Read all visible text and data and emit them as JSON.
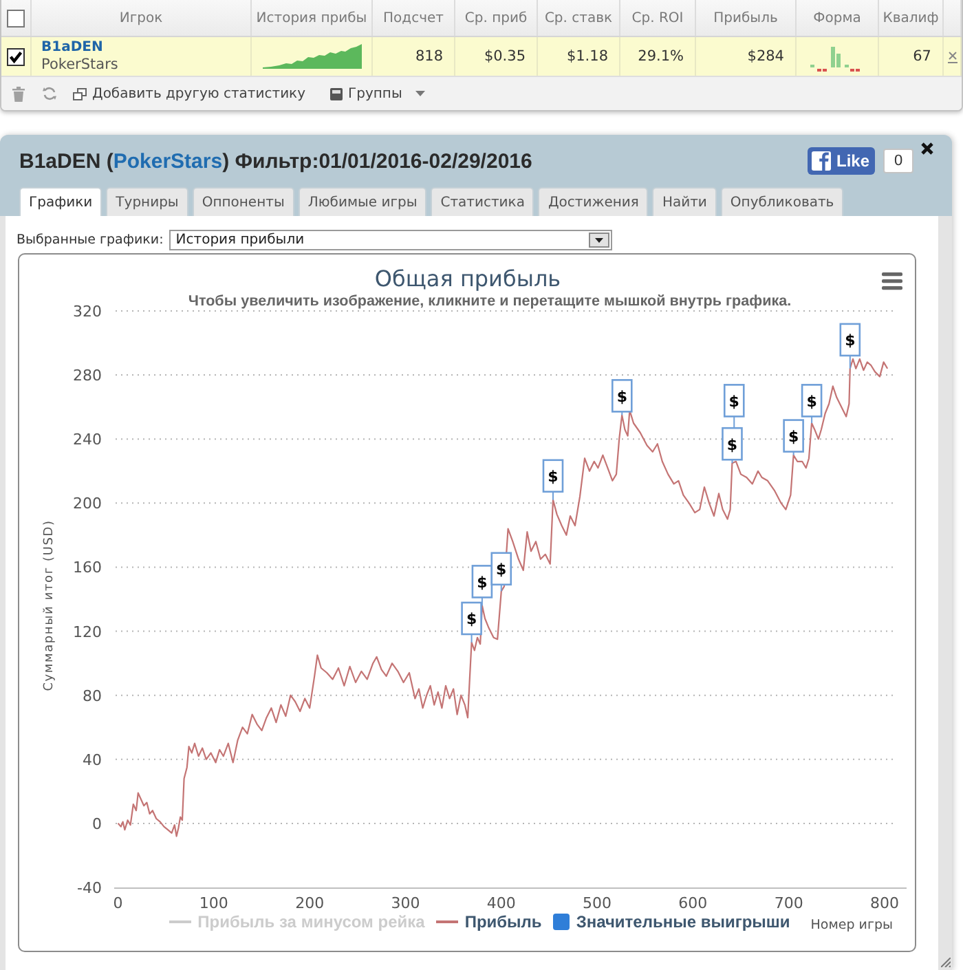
{
  "stats_table": {
    "select_all": {
      "checked": false
    },
    "columns": [
      "Игрок",
      "История прибы",
      "Подсчет",
      "Ср. приб",
      "Ср. ставк",
      "Ср. ROI",
      "Прибыль",
      "Форма",
      "Квалиф"
    ],
    "rows": [
      {
        "checked": true,
        "player": "B1aDEN",
        "site": "PokerStars",
        "count": "818",
        "avg_profit": "$0.35",
        "avg_stake": "$1.18",
        "avg_roi": "29.1%",
        "profit": "$284",
        "qualification": "67"
      }
    ]
  },
  "toolbar": [
    {
      "kind": "delete"
    },
    {
      "kind": "refresh"
    },
    {
      "kind": "add",
      "label": "Добавить другую статистику"
    },
    {
      "kind": "menu",
      "label": "Группы"
    }
  ],
  "panel": {
    "title_start": "B1aDEN (",
    "title_link": "PokerStars",
    "title_end": ") Фильтр:01/01/2016-02/29/2016",
    "like": {
      "label": "Like",
      "count": "0"
    },
    "tabs": [
      {
        "label": "Графики",
        "selected": true
      },
      {
        "label": "Турниры",
        "selected": false
      },
      {
        "label": "Оппоненты",
        "selected": false
      },
      {
        "label": "Любимые игры",
        "selected": false
      },
      {
        "label": "Статистика",
        "selected": false
      },
      {
        "label": "Достижения",
        "selected": false
      },
      {
        "label": "Найти",
        "selected": false
      },
      {
        "label": "Опубликовать",
        "selected": false
      }
    ],
    "chart_select": {
      "label": "Выбранные графики:",
      "value": "История прибыли"
    },
    "chart": {
      "subtitle": "Чтобы увеличить изображение, кликните и перетащите мышкой внутрь графика.",
      "chart_data": {
        "type": "line",
        "title": "Общая прибыль",
        "xlabel": "Номер игры",
        "ylabel": "Суммарный итог (USD)",
        "grid": true,
        "xlim": [
          -4,
          823
        ],
        "ylim": [
          -40,
          320
        ],
        "xticks": [
          0,
          100,
          200,
          300,
          400,
          500,
          600,
          700,
          800
        ],
        "yticks": [
          -40,
          0,
          40,
          80,
          120,
          160,
          200,
          240,
          280,
          320
        ],
        "x": [
          0,
          3,
          5,
          7,
          10,
          13,
          16,
          19,
          21,
          24,
          27,
          30,
          33,
          36,
          40,
          44,
          48,
          52,
          56,
          59,
          61,
          63,
          65,
          67,
          69,
          72,
          74,
          77,
          80,
          84,
          88,
          92,
          97,
          102,
          106,
          110,
          115,
          120,
          125,
          130,
          135,
          140,
          145,
          150,
          155,
          160,
          165,
          170,
          175,
          180,
          185,
          190,
          195,
          200,
          205,
          208,
          212,
          218,
          224,
          230,
          236,
          242,
          248,
          254,
          260,
          266,
          270,
          275,
          280,
          286,
          292,
          298,
          304,
          310,
          314,
          318,
          322,
          326,
          330,
          334,
          338,
          342,
          346,
          350,
          354,
          358,
          362,
          365,
          367,
          369,
          372,
          375,
          378,
          380,
          383,
          387,
          392,
          396,
          400,
          403,
          407,
          412,
          418,
          423,
          427,
          431,
          436,
          441,
          446,
          451,
          454,
          458,
          463,
          468,
          472,
          477,
          482,
          487,
          492,
          497,
          501,
          506,
          511,
          516,
          520,
          523,
          526,
          529,
          532,
          534,
          538,
          545,
          552,
          558,
          563,
          568,
          574,
          580,
          585,
          590,
          596,
          602,
          607,
          612,
          617,
          622,
          627,
          631,
          636,
          639,
          641,
          645,
          650,
          656,
          662,
          668,
          672,
          678,
          685,
          692,
          697,
          702,
          705,
          709,
          714,
          718,
          721,
          724,
          727,
          731,
          734,
          738,
          742,
          746,
          750,
          755,
          760,
          763,
          764,
          767,
          770,
          774,
          778,
          782,
          786,
          790,
          795,
          799,
          803
        ],
        "series": [
          {
            "name": "Прибыль",
            "color": "#c47474",
            "values": [
              0,
              -2,
              1,
              -4,
              2,
              -1,
              12,
              8,
              19,
              15,
              11,
              13,
              6,
              8,
              3,
              1,
              -2,
              -4,
              -6,
              -1,
              -8,
              -3,
              4,
              2,
              28,
              35,
              48,
              44,
              50,
              42,
              47,
              40,
              44,
              38,
              46,
              42,
              50,
              38,
              52,
              60,
              56,
              68,
              62,
              58,
              66,
              72,
              63,
              74,
              67,
              80,
              76,
              70,
              78,
              72,
              92,
              105,
              97,
              94,
              90,
              97,
              86,
              98,
              88,
              95,
              90,
              100,
              104,
              96,
              92,
              100,
              95,
              88,
              94,
              78,
              84,
              72,
              80,
              86,
              74,
              82,
              72,
              86,
              78,
              84,
              68,
              80,
              74,
              66,
              90,
              113,
              108,
              116,
              112,
              136,
              128,
              122,
              116,
              115,
              145,
              148,
              184,
              176,
              165,
              158,
              182,
              170,
              176,
              165,
              168,
              162,
              202,
              193,
              186,
              180,
              192,
              186,
              204,
              228,
              220,
              226,
              222,
              230,
              222,
              214,
              218,
              240,
              255,
              246,
              242,
              258,
              250,
              244,
              236,
              232,
              237,
              226,
              218,
              212,
              214,
              205,
              200,
              194,
              196,
              210,
              200,
              192,
              206,
              196,
              190,
              196,
              225,
              226,
              218,
              216,
              212,
              220,
              216,
              214,
              208,
              200,
              196,
              205,
              230,
              226,
              226,
              222,
              228,
              250,
              246,
              240,
              246,
              256,
              262,
              273,
              266,
              260,
              254,
              262,
              284,
              290,
              284,
              290,
              283,
              288,
              286,
              282,
              279,
              288,
              284
            ]
          }
        ],
        "annotations": [
          {
            "x": 369,
            "y": 128,
            "text": "$"
          },
          {
            "x": 380,
            "y": 151,
            "text": "$"
          },
          {
            "x": 400,
            "y": 159,
            "text": "$"
          },
          {
            "x": 454,
            "y": 217,
            "text": "$"
          },
          {
            "x": 526,
            "y": 267,
            "text": "$"
          },
          {
            "x": 641,
            "y": 237,
            "text": "$"
          },
          {
            "x": 643,
            "y": 264,
            "text": "$"
          },
          {
            "x": 705,
            "y": 242,
            "text": "$"
          },
          {
            "x": 724,
            "y": 264,
            "text": "$"
          },
          {
            "x": 764,
            "y": 302,
            "text": "$"
          }
        ]
      },
      "legend": [
        {
          "kind": "line",
          "label": "Прибыль за минусом рейка",
          "enabled": false
        },
        {
          "kind": "series",
          "enabled": true
        },
        {
          "kind": "flag",
          "label": "Значительные выигрыши",
          "enabled": true,
          "color": "#2f7ed8"
        }
      ]
    }
  }
}
